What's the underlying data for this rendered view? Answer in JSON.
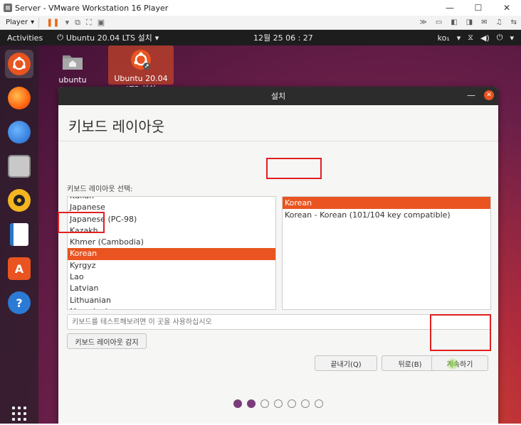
{
  "vmware": {
    "title": "Server - VMware Workstation 16 Player",
    "window_buttons": [
      "—",
      "☐",
      "✕"
    ],
    "player_menu": "Player",
    "right_icons": [
      "≫",
      "▭",
      "◧",
      "◨",
      "✉",
      "♫",
      "⇆"
    ]
  },
  "ubuntu": {
    "activities": "Activities",
    "app_menu": "Ubuntu 20.04 LTS 설치",
    "clock": "12월 25  06 : 27",
    "input_method": "ko₁",
    "desktop_icons": [
      {
        "label": "ubuntu"
      },
      {
        "label": "Ubuntu 20.04 LTS 설치"
      }
    ],
    "dock": [
      "ubuntu-installer",
      "firefox",
      "thunderbird",
      "files",
      "rhythmbox",
      "writer",
      "software",
      "help"
    ]
  },
  "installer": {
    "window_title": "설치",
    "heading": "키보드 레이아웃",
    "list_caption": "키보드 레이아웃 선택:",
    "layouts": [
      "Italian",
      "Japanese",
      "Japanese (PC-98)",
      "Kazakh",
      "Khmer (Cambodia)",
      "Korean",
      "Kyrgyz",
      "Lao",
      "Latvian",
      "Lithuanian",
      "Macedonian"
    ],
    "selected_layout": "Korean",
    "variants": [
      "Korean",
      "Korean - Korean (101/104 key compatible)"
    ],
    "selected_variant": "Korean",
    "test_placeholder": "키보드를 테스트해보려면 이 곳을 사용하십시오",
    "detect_button": "키보드 레이아웃 감지",
    "quit_button": "끝내기(Q)",
    "back_button": "뒤로(B)",
    "continue_button": "계속하기",
    "progress": {
      "total": 7,
      "completed": 2
    }
  },
  "colors": {
    "accent": "#e95420",
    "annotation": "#e02020",
    "progress_done": "#7a3d7a"
  }
}
